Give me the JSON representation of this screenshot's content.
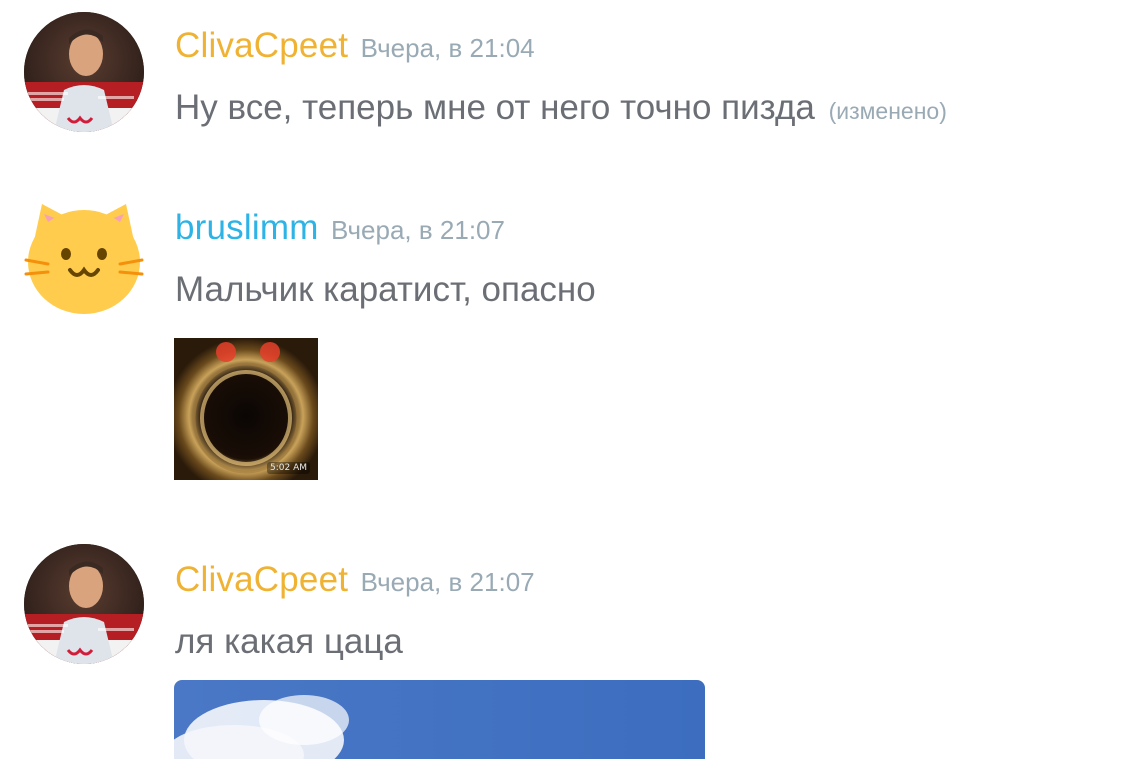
{
  "colors": {
    "user1_name": "#f0b232",
    "user2_name": "#2db3e6",
    "timestamp": "#99aab5",
    "message_text": "#6b6f75"
  },
  "messages": [
    {
      "author": "ClivaCpeet",
      "timestamp": "Вчера, в 21:04",
      "text": "Ну все, теперь мне от него точно пизда",
      "edited": "(изменено)",
      "avatar": "photo-avatar"
    },
    {
      "author": "bruslimm",
      "timestamp": "Вчера, в 21:07",
      "text": "Мальчик каратист, опасно",
      "avatar": "cat-avatar",
      "attachment": {
        "type": "gif-thumbnail",
        "time_overlay": "5:02 AM"
      }
    },
    {
      "author": "ClivaCpeet",
      "timestamp": "Вчера, в 21:07",
      "text": "ля какая цаца",
      "avatar": "photo-avatar",
      "attachment": {
        "type": "sky-photo"
      }
    }
  ]
}
